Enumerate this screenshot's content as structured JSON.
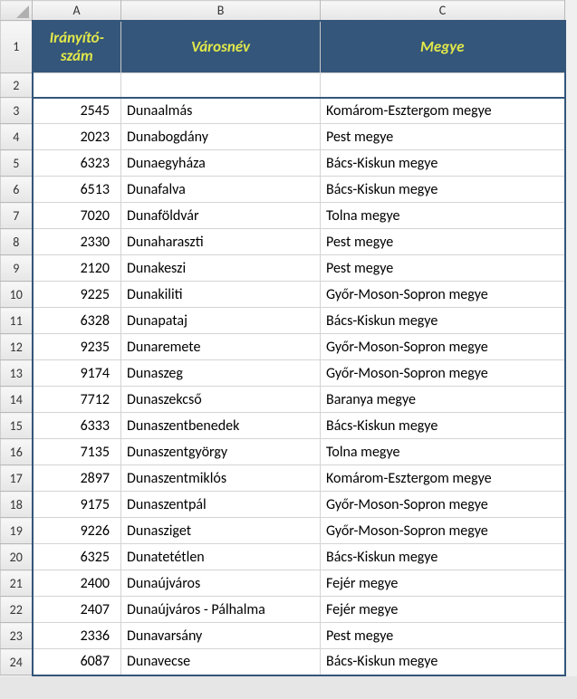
{
  "columns": [
    "A",
    "B",
    "C"
  ],
  "rowNumbers": [
    1,
    2,
    3,
    4,
    5,
    6,
    7,
    8,
    9,
    10,
    11,
    12,
    13,
    14,
    15,
    16,
    17,
    18,
    19,
    20,
    21,
    22,
    23,
    24
  ],
  "headers": {
    "A": "Irányító-\nszám",
    "B": "Városnév",
    "C": "Megye"
  },
  "rows": [
    {
      "A": "2545",
      "B": "Dunaalmás",
      "C": "Komárom-Esztergom megye"
    },
    {
      "A": "2023",
      "B": "Dunabogdány",
      "C": "Pest megye"
    },
    {
      "A": "6323",
      "B": "Dunaegyháza",
      "C": "Bács-Kiskun megye"
    },
    {
      "A": "6513",
      "B": "Dunafalva",
      "C": "Bács-Kiskun megye"
    },
    {
      "A": "7020",
      "B": "Dunaföldvár",
      "C": "Tolna megye"
    },
    {
      "A": "2330",
      "B": "Dunaharaszti",
      "C": "Pest megye"
    },
    {
      "A": "2120",
      "B": "Dunakeszi",
      "C": "Pest megye"
    },
    {
      "A": "9225",
      "B": "Dunakiliti",
      "C": "Győr-Moson-Sopron megye"
    },
    {
      "A": "6328",
      "B": "Dunapataj",
      "C": "Bács-Kiskun megye"
    },
    {
      "A": "9235",
      "B": "Dunaremete",
      "C": "Győr-Moson-Sopron megye"
    },
    {
      "A": "9174",
      "B": "Dunaszeg",
      "C": "Győr-Moson-Sopron megye"
    },
    {
      "A": "7712",
      "B": "Dunaszekcső",
      "C": "Baranya megye"
    },
    {
      "A": "6333",
      "B": "Dunaszentbenedek",
      "C": "Bács-Kiskun megye"
    },
    {
      "A": "7135",
      "B": "Dunaszentgyörgy",
      "C": "Tolna megye"
    },
    {
      "A": "2897",
      "B": "Dunaszentmiklós",
      "C": "Komárom-Esztergom megye"
    },
    {
      "A": "9175",
      "B": "Dunaszentpál",
      "C": "Győr-Moson-Sopron megye"
    },
    {
      "A": "9226",
      "B": "Dunasziget",
      "C": "Győr-Moson-Sopron megye"
    },
    {
      "A": "6325",
      "B": "Dunatetétlen",
      "C": "Bács-Kiskun megye"
    },
    {
      "A": "2400",
      "B": "Dunaújváros",
      "C": "Fejér megye"
    },
    {
      "A": "2407",
      "B": "Dunaújváros - Pálhalma",
      "C": "Fejér megye"
    },
    {
      "A": "2336",
      "B": "Dunavarsány",
      "C": "Pest megye"
    },
    {
      "A": "6087",
      "B": "Dunavecse",
      "C": "Bács-Kiskun megye"
    }
  ]
}
